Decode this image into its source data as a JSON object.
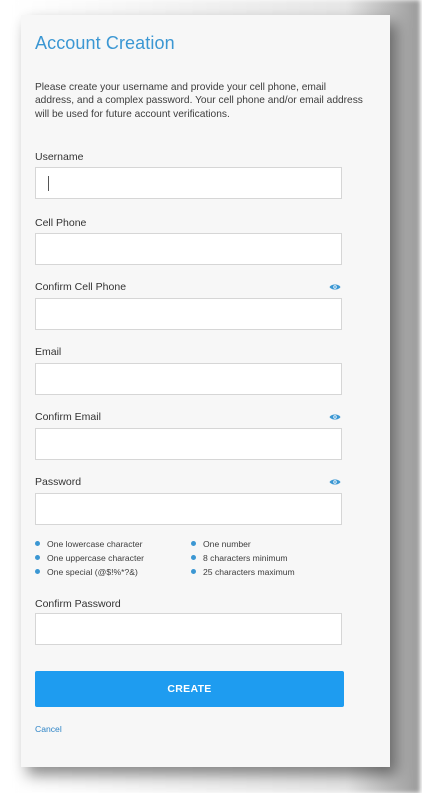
{
  "form": {
    "title": "Account Creation",
    "instructions": "Please create your username and provide your cell phone, email address, and a complex password. Your cell phone and/or email address will be used for future account verifications.",
    "fields": {
      "username": {
        "label": "Username",
        "value": ""
      },
      "cell_phone": {
        "label": "Cell Phone",
        "value": ""
      },
      "confirm_cell_phone": {
        "label": "Confirm Cell Phone",
        "value": ""
      },
      "email": {
        "label": "Email",
        "value": ""
      },
      "confirm_email": {
        "label": "Confirm Email",
        "value": ""
      },
      "password": {
        "label": "Password",
        "value": ""
      },
      "confirm_password": {
        "label": "Confirm Password",
        "value": ""
      }
    },
    "password_rules": {
      "left": [
        "One lowercase character",
        "One uppercase character",
        "One special (@$!%*?&)"
      ],
      "right": [
        "One number",
        "8 characters minimum",
        "25 characters maximum"
      ]
    },
    "create_label": "CREATE",
    "cancel_label": "Cancel",
    "icons": {
      "show_password": "eye-icon"
    },
    "colors": {
      "accent": "#3b97d3",
      "button": "#1e9cf0",
      "link": "#2f85c7"
    }
  }
}
